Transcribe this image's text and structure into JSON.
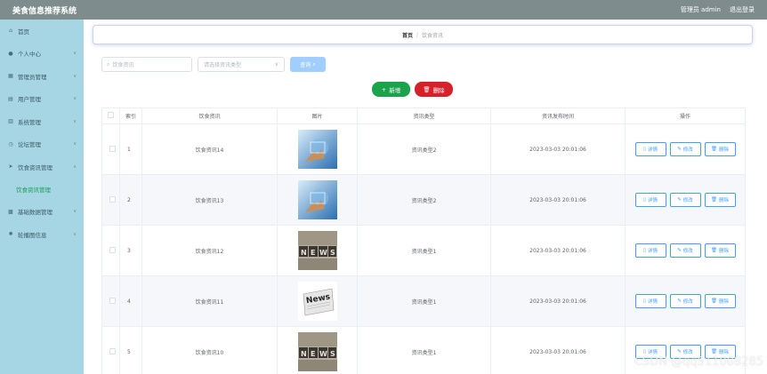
{
  "header": {
    "title": "美食信息推荐系统",
    "user_label": "管理员 admin",
    "logout_label": "退出登录"
  },
  "sidebar": {
    "items": [
      {
        "label": "首页",
        "icon": "home-icon"
      },
      {
        "label": "个人中心",
        "icon": "user-icon"
      },
      {
        "label": "管理员管理",
        "icon": "admin-icon"
      },
      {
        "label": "用户管理",
        "icon": "users-icon"
      },
      {
        "label": "系统管理",
        "icon": "settings-icon"
      },
      {
        "label": "论坛管理",
        "icon": "forum-icon"
      },
      {
        "label": "饮食资讯管理",
        "icon": "send-icon"
      }
    ],
    "active_sub": "饮食资讯管理",
    "items_after": [
      {
        "label": "基础数据管理",
        "icon": "database-icon"
      },
      {
        "label": "轮播图信息",
        "icon": "carousel-icon"
      }
    ]
  },
  "breadcrumb": {
    "home": "首页",
    "separator": "/",
    "current": "饮食资讯"
  },
  "search": {
    "input_placeholder": "饮食资讯",
    "select_placeholder": "请选择资讯类型",
    "query_label": "查询"
  },
  "actions": {
    "add_label": "新增",
    "delete_label": "删除"
  },
  "table": {
    "headers": [
      "索引",
      "饮食资讯",
      "图片",
      "资讯类型",
      "资讯发布时间",
      "操作"
    ],
    "rows": [
      {
        "index": "1",
        "name": "饮食资讯14",
        "image": "tech-hand",
        "type": "资讯类型2",
        "time": "2023-03-03 20:01:06"
      },
      {
        "index": "2",
        "name": "饮食资讯13",
        "image": "tech-hand",
        "type": "资讯类型2",
        "time": "2023-03-03 20:01:06"
      },
      {
        "index": "3",
        "name": "饮食资讯12",
        "image": "news-blocks",
        "type": "资讯类型1",
        "time": "2023-03-03 20:01:06"
      },
      {
        "index": "4",
        "name": "饮食资讯11",
        "image": "news-paper",
        "type": "资讯类型1",
        "time": "2023-03-03 20:01:06"
      },
      {
        "index": "5",
        "name": "饮食资讯10",
        "image": "news-blocks",
        "type": "资讯类型1",
        "time": "2023-03-03 20:01:06"
      }
    ],
    "op_labels": {
      "detail": "详情",
      "edit": "修改",
      "delete": "删除"
    }
  },
  "watermark": "CSDN @qq511008285",
  "colors": {
    "topbar": "#7f8c8d",
    "sidebar": "#a6d5e3",
    "add_button": "#1aa34a",
    "delete_button": "#d6202a",
    "query_button": "#a0cfff",
    "op_button": "#409eff",
    "active_sub": "#1aa05a"
  }
}
